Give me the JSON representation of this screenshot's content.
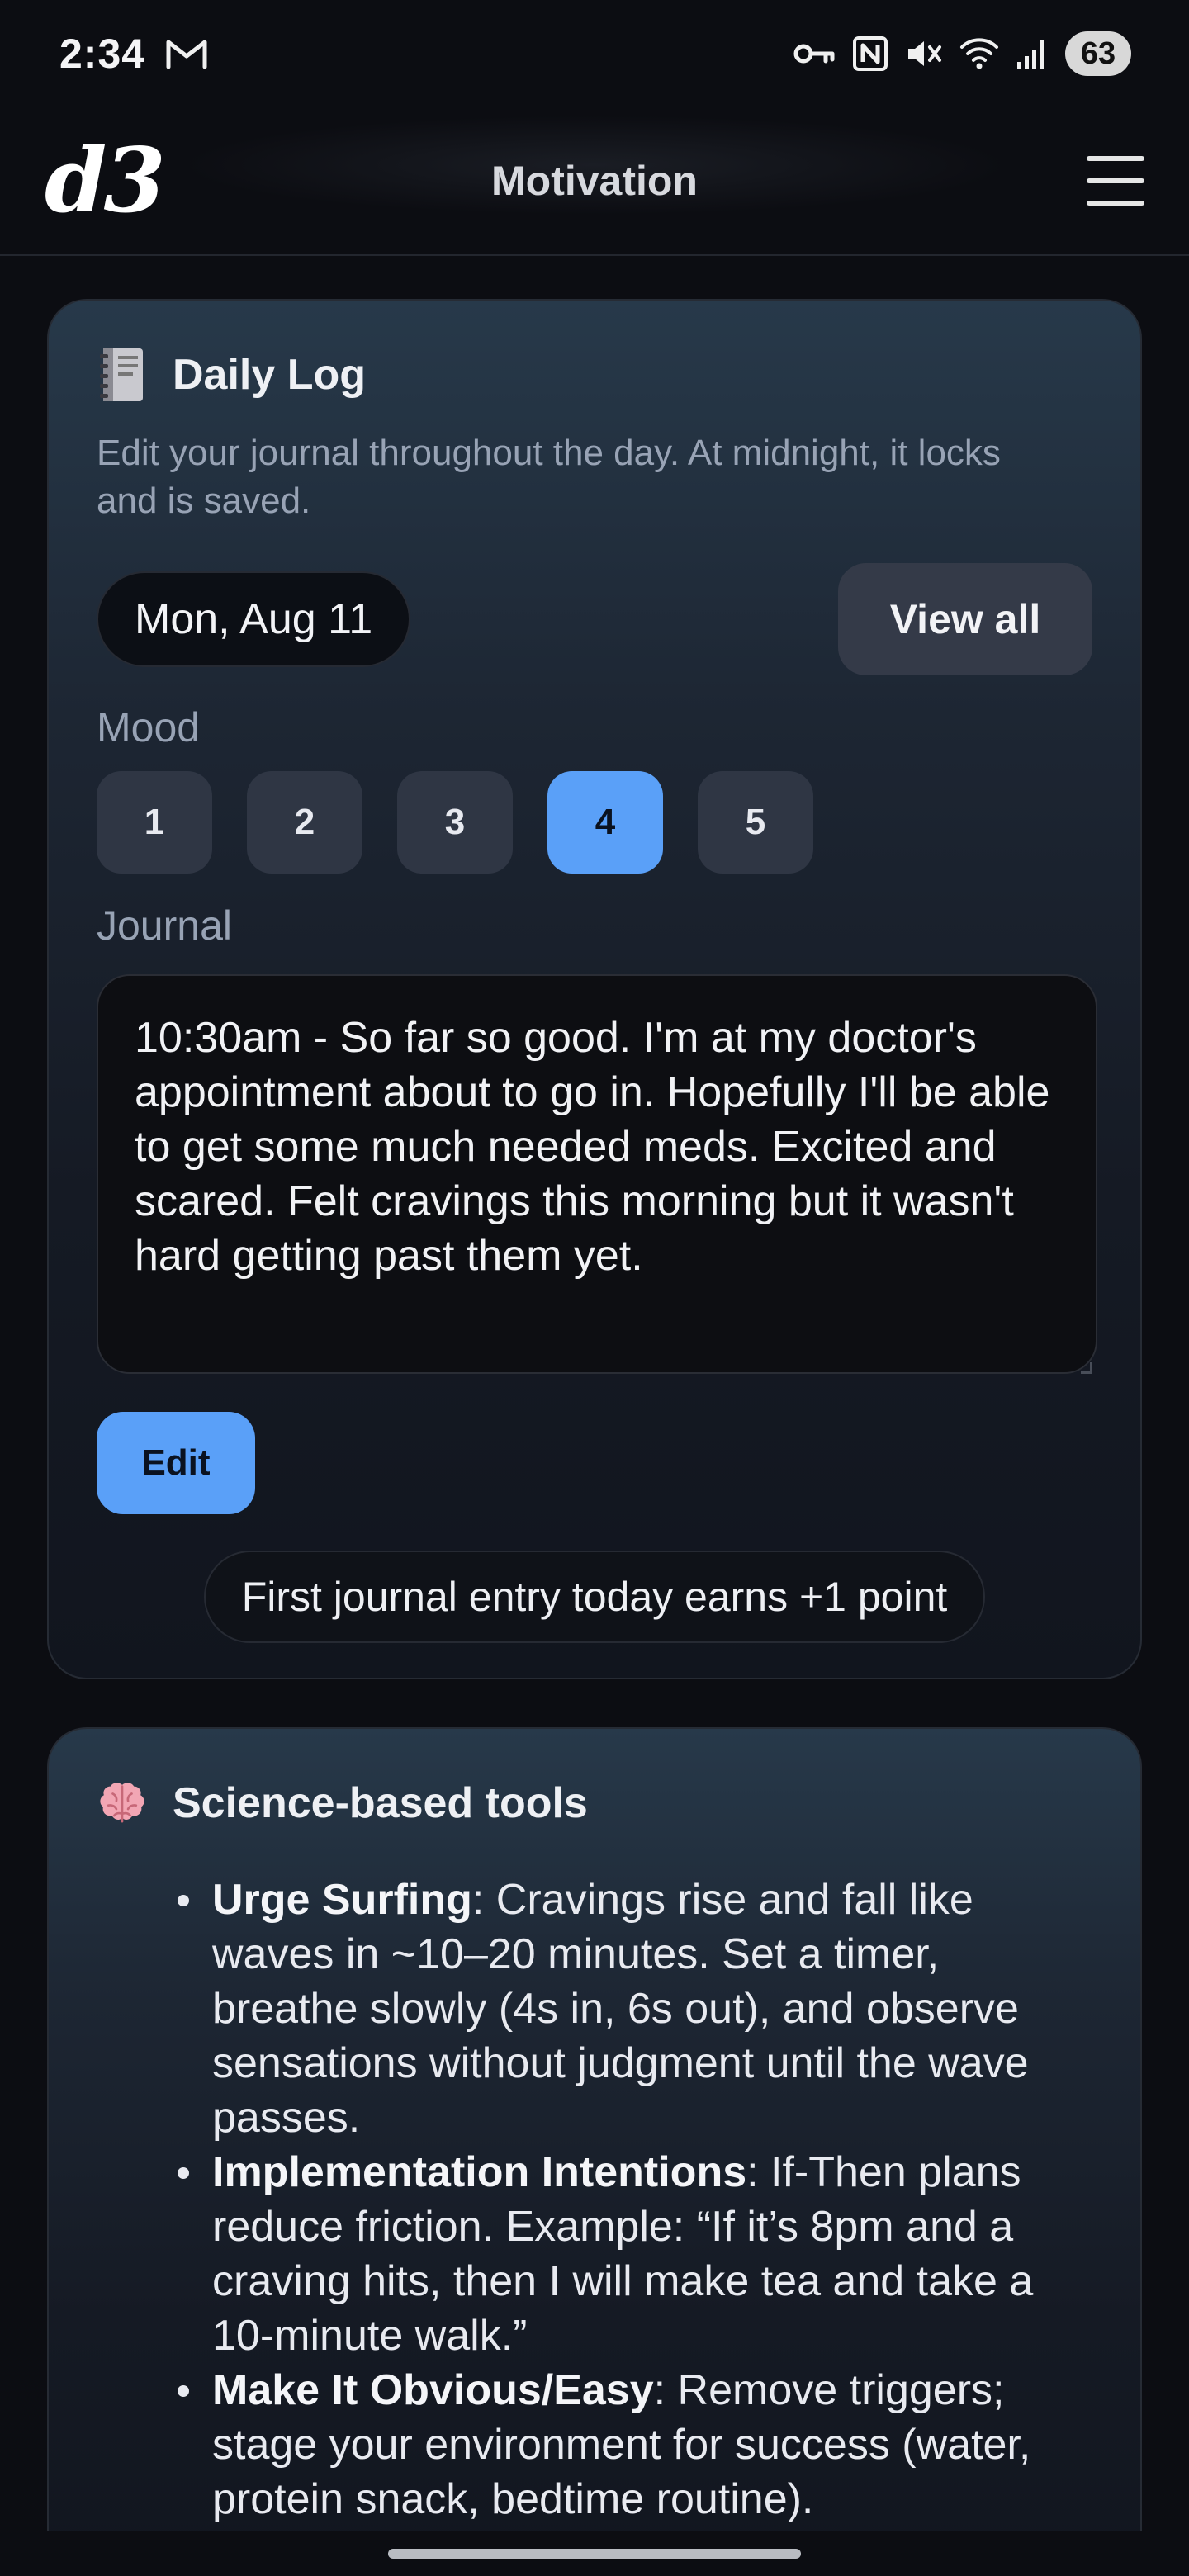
{
  "status_bar": {
    "time": "2:34",
    "battery": "63",
    "icons": [
      "gmail-icon",
      "key-icon",
      "nfc-icon",
      "mute-icon",
      "wifi-icon",
      "signal-icon"
    ]
  },
  "header": {
    "logo": "d3",
    "title": "Motivation",
    "menu_icon": "hamburger-menu-icon"
  },
  "daily_log": {
    "icon": "notebook-icon",
    "title": "Daily Log",
    "description": "Edit your journal throughout the day. At midnight, it locks and is saved.",
    "date": "Mon, Aug 11",
    "view_all_label": "View all",
    "mood_label": "Mood",
    "mood_options": [
      "1",
      "2",
      "3",
      "4",
      "5"
    ],
    "mood_selected": "4",
    "journal_label": "Journal",
    "journal_text": "10:30am - So far so good. I'm at my doctor's appointment about to go in. Hopefully I'll be able to get some much needed meds. Excited and scared. Felt cravings this morning but it wasn't hard getting past them yet.",
    "edit_label": "Edit",
    "points_note": "First journal entry today earns +1 point"
  },
  "tools": {
    "icon": "brain-icon",
    "title": "Science-based tools",
    "items": [
      {
        "term": "Urge Surfing",
        "text": ": Cravings rise and fall like waves in ~10–20 minutes. Set a timer, breathe slowly (4s in, 6s out), and observe sensations without judgment until the wave passes."
      },
      {
        "term": "Implementation Intentions",
        "text": ": If-Then plans reduce friction. Example: “If it’s 8pm and a craving hits, then I will make tea and take a 10-minute walk.”"
      },
      {
        "term": "Make It Obvious/Easy",
        "text": ": Remove triggers; stage your environment for success (water, protein snack, bedtime routine)."
      }
    ]
  },
  "colors": {
    "accent": "#5aa0f8",
    "background": "#0c0d12",
    "muted_text": "#98a3b5"
  }
}
